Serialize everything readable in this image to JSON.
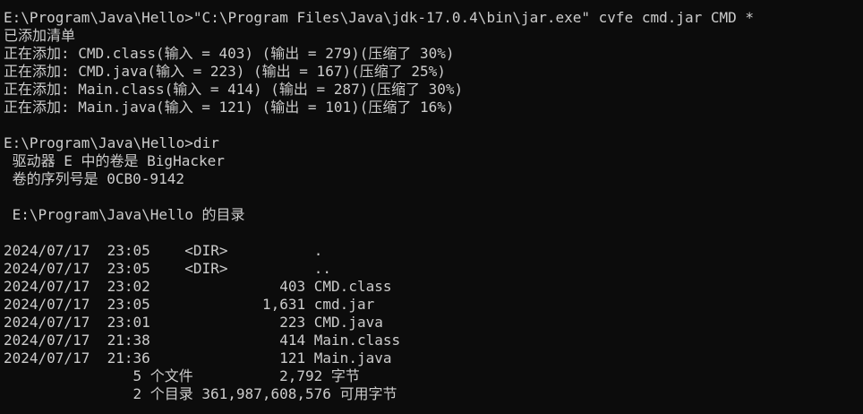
{
  "terminal": {
    "lines": [
      "E:\\Program\\Java\\Hello>\"C:\\Program Files\\Java\\jdk-17.0.4\\bin\\jar.exe\" cvfe cmd.jar CMD *",
      "已添加清单",
      "正在添加: CMD.class(输入 = 403) (输出 = 279)(压缩了 30%)",
      "正在添加: CMD.java(输入 = 223) (输出 = 167)(压缩了 25%)",
      "正在添加: Main.class(输入 = 414) (输出 = 287)(压缩了 30%)",
      "正在添加: Main.java(输入 = 121) (输出 = 101)(压缩了 16%)",
      "",
      "E:\\Program\\Java\\Hello>dir",
      " 驱动器 E 中的卷是 BigHacker",
      " 卷的序列号是 0CB0-9142",
      "",
      " E:\\Program\\Java\\Hello 的目录",
      "",
      "2024/07/17  23:05    <DIR>          .",
      "2024/07/17  23:05    <DIR>          ..",
      "2024/07/17  23:02               403 CMD.class",
      "2024/07/17  23:05             1,631 cmd.jar",
      "2024/07/17  23:01               223 CMD.java",
      "2024/07/17  21:38               414 Main.class",
      "2024/07/17  21:36               121 Main.java",
      "               5 个文件          2,792 字节",
      "               2 个目录 361,987,608,576 可用字节"
    ]
  }
}
